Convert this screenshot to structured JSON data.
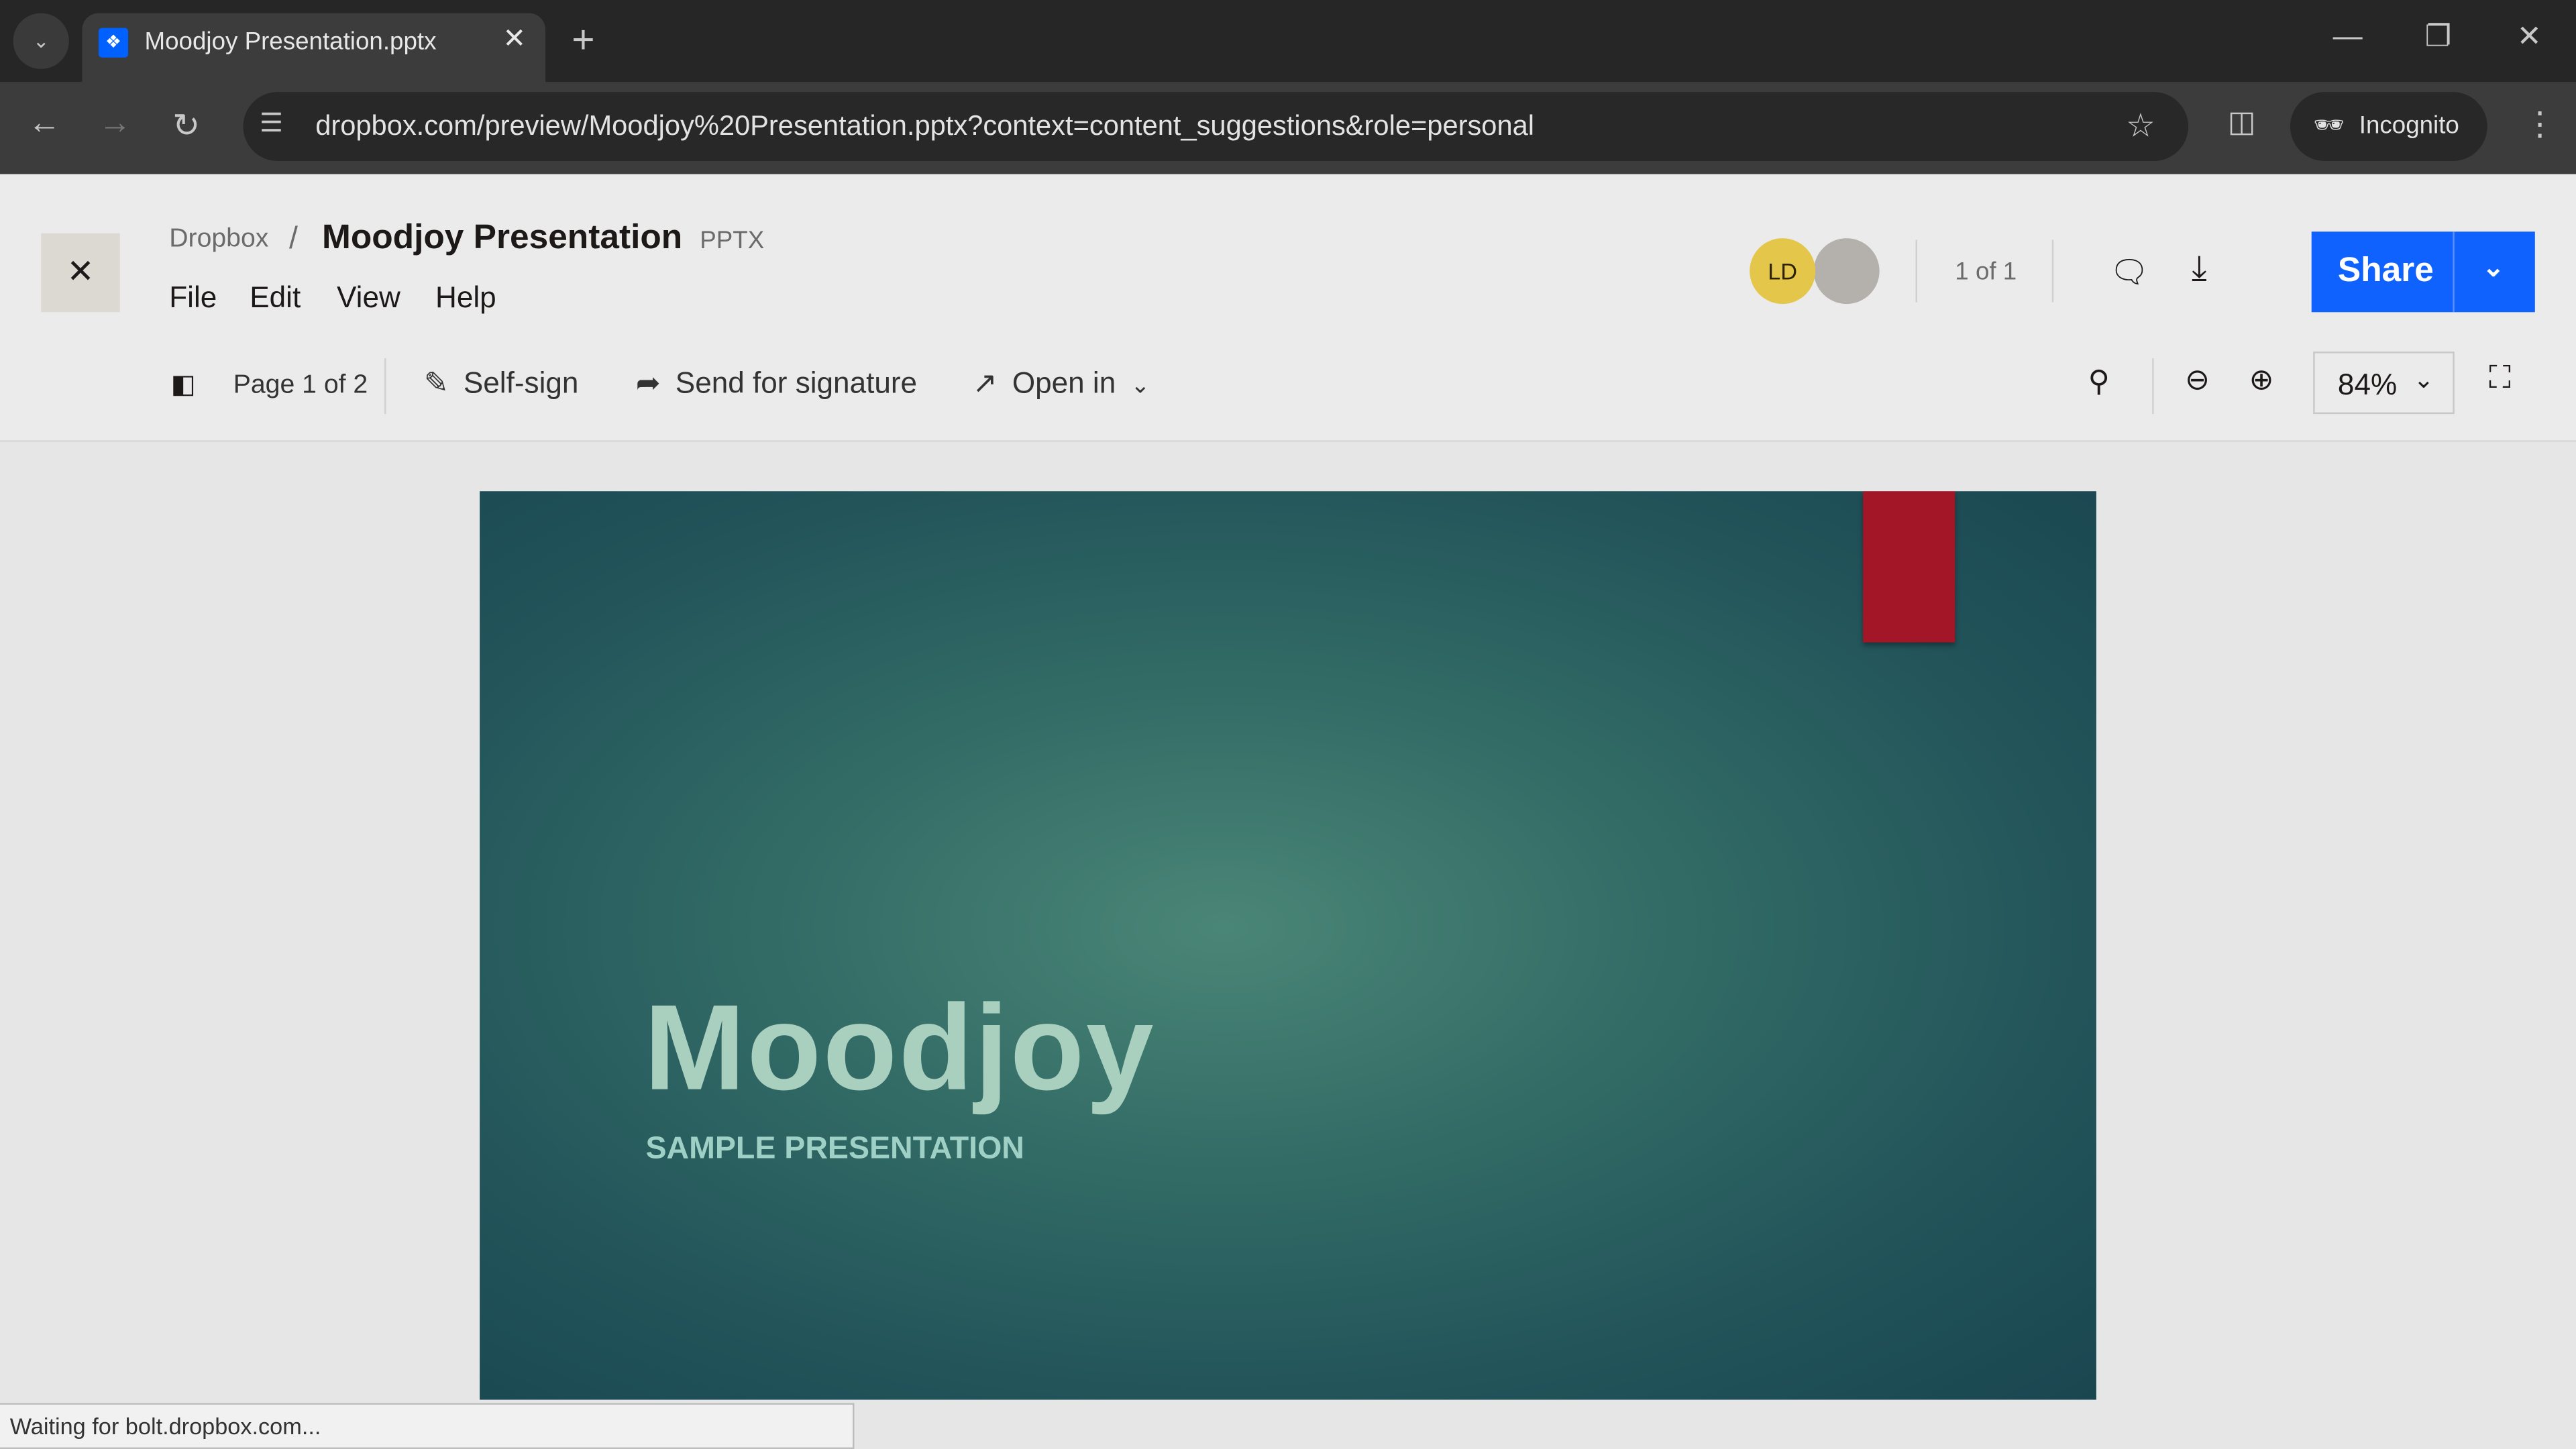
{
  "browser": {
    "tab_title": "Moodjoy Presentation.pptx",
    "url": "dropbox.com/preview/Moodjoy%20Presentation.pptx?context=content_suggestions&role=personal",
    "incognito_label": "Incognito"
  },
  "header": {
    "breadcrumb_root": "Dropbox",
    "separator": "/",
    "file_title": "Moodjoy Presentation",
    "file_type": "PPTX",
    "menu": [
      "File",
      "Edit",
      "View",
      "Help"
    ],
    "avatar_initials": "LD",
    "version_count": "1 of 1",
    "share_label": "Share",
    "colors": {
      "share": "#0f62fe",
      "avatar": "#e4c74a"
    }
  },
  "toolbar": {
    "page_indicator": "Page 1 of 2",
    "self_sign": "Self-sign",
    "send_for_signature": "Send for signature",
    "open_in": "Open in",
    "zoom_level": "84%"
  },
  "slide": {
    "title": "Moodjoy",
    "subtitle": "SAMPLE PRESENTATION",
    "colors": {
      "accent": "#a31627",
      "title": "#a9cfbf"
    }
  },
  "status_bar": {
    "text": "Waiting for bolt.dropbox.com..."
  }
}
